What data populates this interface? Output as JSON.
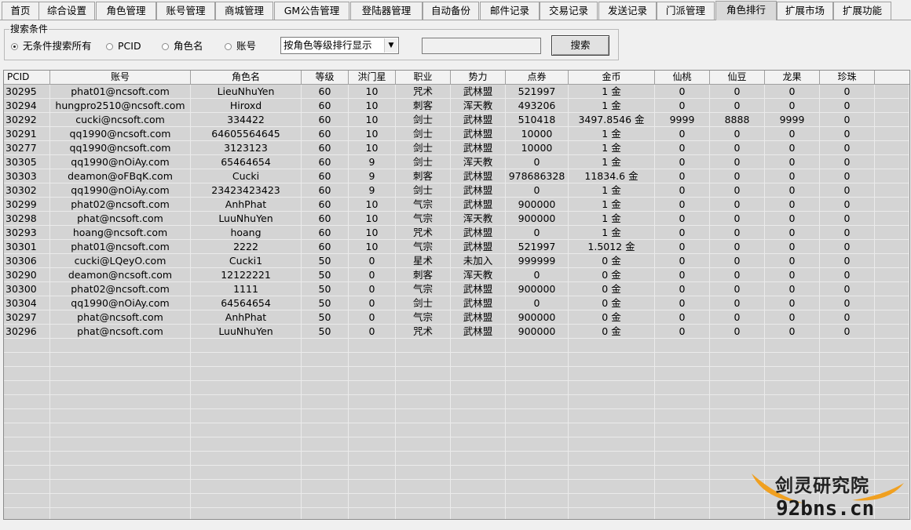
{
  "tabs": [
    {
      "label": "首页"
    },
    {
      "label": "综合设置"
    },
    {
      "label": "角色管理"
    },
    {
      "label": "账号管理"
    },
    {
      "label": "商城管理"
    },
    {
      "label": "GM公告管理"
    },
    {
      "label": "登陆器管理"
    },
    {
      "label": "自动备份"
    },
    {
      "label": "邮件记录"
    },
    {
      "label": "交易记录"
    },
    {
      "label": "发送记录"
    },
    {
      "label": "门派管理"
    },
    {
      "label": "角色排行"
    },
    {
      "label": "扩展市场"
    },
    {
      "label": "扩展功能"
    }
  ],
  "active_tab": "角色排行",
  "search": {
    "group_title": "搜索条件",
    "radios": [
      {
        "label": "无条件搜索所有",
        "selected": true
      },
      {
        "label": "PCID",
        "selected": false
      },
      {
        "label": "角色名",
        "selected": false
      },
      {
        "label": "账号",
        "selected": false
      }
    ],
    "sort_select": "按角色等级排行显示",
    "keyword": "",
    "search_button": "搜索"
  },
  "table": {
    "columns": [
      "PCID",
      "账号",
      "角色名",
      "等级",
      "洪门星",
      "职业",
      "势力",
      "点券",
      "金币",
      "仙桃",
      "仙豆",
      "龙果",
      "珍珠"
    ],
    "rows": [
      [
        "30295",
        "phat01@ncsoft.com",
        "LieuNhuYen",
        "60",
        "10",
        "咒术",
        "武林盟",
        "521997",
        "1 金",
        "0",
        "0",
        "0",
        "0"
      ],
      [
        "30294",
        "hungpro2510@ncsoft.com",
        "Hiroxd",
        "60",
        "10",
        "刺客",
        "浑天教",
        "493206",
        "1 金",
        "0",
        "0",
        "0",
        "0"
      ],
      [
        "30292",
        "cucki@ncsoft.com",
        "334422",
        "60",
        "10",
        "剑士",
        "武林盟",
        "510418",
        "3497.8546 金",
        "9999",
        "8888",
        "9999",
        "0"
      ],
      [
        "30291",
        "qq1990@ncsoft.com",
        "64605564645",
        "60",
        "10",
        "剑士",
        "武林盟",
        "10000",
        "1 金",
        "0",
        "0",
        "0",
        "0"
      ],
      [
        "30277",
        "qq1990@ncsoft.com",
        "3123123",
        "60",
        "10",
        "剑士",
        "武林盟",
        "10000",
        "1 金",
        "0",
        "0",
        "0",
        "0"
      ],
      [
        "30305",
        "qq1990@nOiAy.com",
        "65464654",
        "60",
        "9",
        "剑士",
        "浑天教",
        "0",
        "1 金",
        "0",
        "0",
        "0",
        "0"
      ],
      [
        "30303",
        "deamon@oFBqK.com",
        "Cucki",
        "60",
        "9",
        "刺客",
        "武林盟",
        "978686328",
        "11834.6 金",
        "0",
        "0",
        "0",
        "0"
      ],
      [
        "30302",
        "qq1990@nOiAy.com",
        "23423423423",
        "60",
        "9",
        "剑士",
        "武林盟",
        "0",
        "1 金",
        "0",
        "0",
        "0",
        "0"
      ],
      [
        "30299",
        "phat02@ncsoft.com",
        "AnhPhat",
        "60",
        "10",
        "气宗",
        "武林盟",
        "900000",
        "1 金",
        "0",
        "0",
        "0",
        "0"
      ],
      [
        "30298",
        "phat@ncsoft.com",
        "LuuNhuYen",
        "60",
        "10",
        "气宗",
        "浑天教",
        "900000",
        "1 金",
        "0",
        "0",
        "0",
        "0"
      ],
      [
        "30293",
        "hoang@ncsoft.com",
        "hoang",
        "60",
        "10",
        "咒术",
        "武林盟",
        "0",
        "1 金",
        "0",
        "0",
        "0",
        "0"
      ],
      [
        "30301",
        "phat01@ncsoft.com",
        "2222",
        "60",
        "10",
        "气宗",
        "武林盟",
        "521997",
        "1.5012 金",
        "0",
        "0",
        "0",
        "0"
      ],
      [
        "30306",
        "cucki@LQeyO.com",
        "Cucki1",
        "50",
        "0",
        "星术",
        "未加入",
        "999999",
        "0 金",
        "0",
        "0",
        "0",
        "0"
      ],
      [
        "30290",
        "deamon@ncsoft.com",
        "12122221",
        "50",
        "0",
        "刺客",
        "浑天教",
        "0",
        "0 金",
        "0",
        "0",
        "0",
        "0"
      ],
      [
        "30300",
        "phat02@ncsoft.com",
        "1111",
        "50",
        "0",
        "气宗",
        "武林盟",
        "900000",
        "0 金",
        "0",
        "0",
        "0",
        "0"
      ],
      [
        "30304",
        "qq1990@nOiAy.com",
        "64564654",
        "50",
        "0",
        "剑士",
        "武林盟",
        "0",
        "0 金",
        "0",
        "0",
        "0",
        "0"
      ],
      [
        "30297",
        "phat@ncsoft.com",
        "AnhPhat",
        "50",
        "0",
        "气宗",
        "武林盟",
        "900000",
        "0 金",
        "0",
        "0",
        "0",
        "0"
      ],
      [
        "30296",
        "phat@ncsoft.com",
        "LuuNhuYen",
        "50",
        "0",
        "咒术",
        "武林盟",
        "900000",
        "0 金",
        "0",
        "0",
        "0",
        "0"
      ]
    ]
  },
  "watermark": {
    "cn": "剑灵研究院",
    "en": "92bns.cn",
    "accent_color": "#f0a020"
  }
}
